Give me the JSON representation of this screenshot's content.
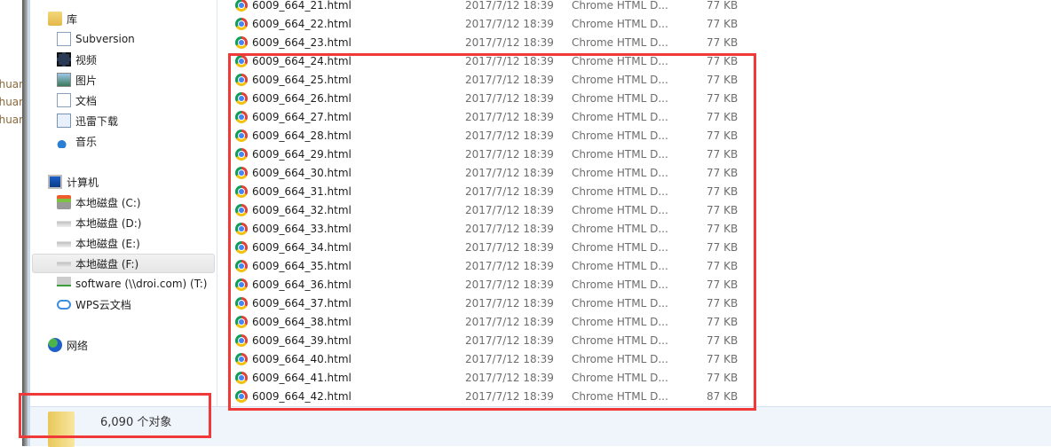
{
  "background_window": {
    "fragments": [
      "chuan",
      "chuan",
      "chuan"
    ]
  },
  "sidebar": {
    "libraries": {
      "label": "库",
      "icon": "library-folder-icon",
      "items": [
        {
          "label": "Subversion",
          "icon": "document-icon"
        },
        {
          "label": "视频",
          "icon": "video-icon"
        },
        {
          "label": "图片",
          "icon": "picture-icon"
        },
        {
          "label": "文档",
          "icon": "document-icon"
        },
        {
          "label": "迅雷下载",
          "icon": "download-icon"
        },
        {
          "label": "音乐",
          "icon": "music-icon"
        }
      ]
    },
    "computer": {
      "label": "计算机",
      "icon": "computer-icon",
      "items": [
        {
          "label": "本地磁盘 (C:)",
          "icon": "system-drive-icon"
        },
        {
          "label": "本地磁盘 (D:)",
          "icon": "drive-icon"
        },
        {
          "label": "本地磁盘 (E:)",
          "icon": "drive-icon"
        },
        {
          "label": "本地磁盘 (F:)",
          "icon": "drive-icon",
          "selected": true
        },
        {
          "label": "software (\\\\droi.com) (T:)",
          "icon": "network-drive-icon"
        },
        {
          "label": "WPS云文档",
          "icon": "cloud-icon"
        }
      ]
    },
    "network": {
      "label": "网络",
      "icon": "network-icon"
    }
  },
  "files": [
    {
      "name": "6009_664_21.html",
      "date": "2017/7/12 18:39",
      "type": "Chrome HTML D...",
      "size": "77 KB"
    },
    {
      "name": "6009_664_22.html",
      "date": "2017/7/12 18:39",
      "type": "Chrome HTML D...",
      "size": "77 KB"
    },
    {
      "name": "6009_664_23.html",
      "date": "2017/7/12 18:39",
      "type": "Chrome HTML D...",
      "size": "77 KB"
    },
    {
      "name": "6009_664_24.html",
      "date": "2017/7/12 18:39",
      "type": "Chrome HTML D...",
      "size": "77 KB"
    },
    {
      "name": "6009_664_25.html",
      "date": "2017/7/12 18:39",
      "type": "Chrome HTML D...",
      "size": "77 KB"
    },
    {
      "name": "6009_664_26.html",
      "date": "2017/7/12 18:39",
      "type": "Chrome HTML D...",
      "size": "77 KB"
    },
    {
      "name": "6009_664_27.html",
      "date": "2017/7/12 18:39",
      "type": "Chrome HTML D...",
      "size": "77 KB"
    },
    {
      "name": "6009_664_28.html",
      "date": "2017/7/12 18:39",
      "type": "Chrome HTML D...",
      "size": "77 KB"
    },
    {
      "name": "6009_664_29.html",
      "date": "2017/7/12 18:39",
      "type": "Chrome HTML D...",
      "size": "77 KB"
    },
    {
      "name": "6009_664_30.html",
      "date": "2017/7/12 18:39",
      "type": "Chrome HTML D...",
      "size": "77 KB"
    },
    {
      "name": "6009_664_31.html",
      "date": "2017/7/12 18:39",
      "type": "Chrome HTML D...",
      "size": "77 KB"
    },
    {
      "name": "6009_664_32.html",
      "date": "2017/7/12 18:39",
      "type": "Chrome HTML D...",
      "size": "77 KB"
    },
    {
      "name": "6009_664_33.html",
      "date": "2017/7/12 18:39",
      "type": "Chrome HTML D...",
      "size": "77 KB"
    },
    {
      "name": "6009_664_34.html",
      "date": "2017/7/12 18:39",
      "type": "Chrome HTML D...",
      "size": "77 KB"
    },
    {
      "name": "6009_664_35.html",
      "date": "2017/7/12 18:39",
      "type": "Chrome HTML D...",
      "size": "77 KB"
    },
    {
      "name": "6009_664_36.html",
      "date": "2017/7/12 18:39",
      "type": "Chrome HTML D...",
      "size": "77 KB"
    },
    {
      "name": "6009_664_37.html",
      "date": "2017/7/12 18:39",
      "type": "Chrome HTML D...",
      "size": "77 KB"
    },
    {
      "name": "6009_664_38.html",
      "date": "2017/7/12 18:39",
      "type": "Chrome HTML D...",
      "size": "77 KB"
    },
    {
      "name": "6009_664_39.html",
      "date": "2017/7/12 18:39",
      "type": "Chrome HTML D...",
      "size": "77 KB"
    },
    {
      "name": "6009_664_40.html",
      "date": "2017/7/12 18:39",
      "type": "Chrome HTML D...",
      "size": "77 KB"
    },
    {
      "name": "6009_664_41.html",
      "date": "2017/7/12 18:39",
      "type": "Chrome HTML D...",
      "size": "77 KB"
    },
    {
      "name": "6009_664_42.html",
      "date": "2017/7/12 18:39",
      "type": "Chrome HTML D...",
      "size": "87 KB"
    }
  ],
  "status": {
    "count_text": "6,090 个对象",
    "icon": "folder-icon"
  },
  "annotation_color": "#f03a3a"
}
